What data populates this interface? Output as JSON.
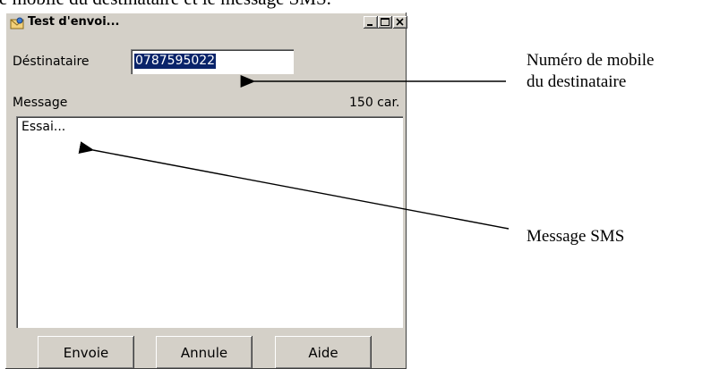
{
  "document": {
    "top_line": "e mobile du destinataire et le message SMS."
  },
  "window": {
    "title": "Test d'envoi...",
    "title_icon": "mail-envelope-icon",
    "controls": {
      "minimize": "minimize-icon",
      "maximize": "maximize-icon",
      "close": "close-icon"
    }
  },
  "form": {
    "recipient_label": "Déstinataire",
    "recipient_value": "0787595022",
    "message_label": "Message",
    "char_count": "150 car.",
    "message_value": "Essai..."
  },
  "buttons": {
    "send": "Envoie",
    "cancel": "Annule",
    "help": "Aide"
  },
  "callouts": {
    "recipient_line1": "Numéro de mobile",
    "recipient_line2": "du destinataire",
    "message": "Message SMS"
  }
}
